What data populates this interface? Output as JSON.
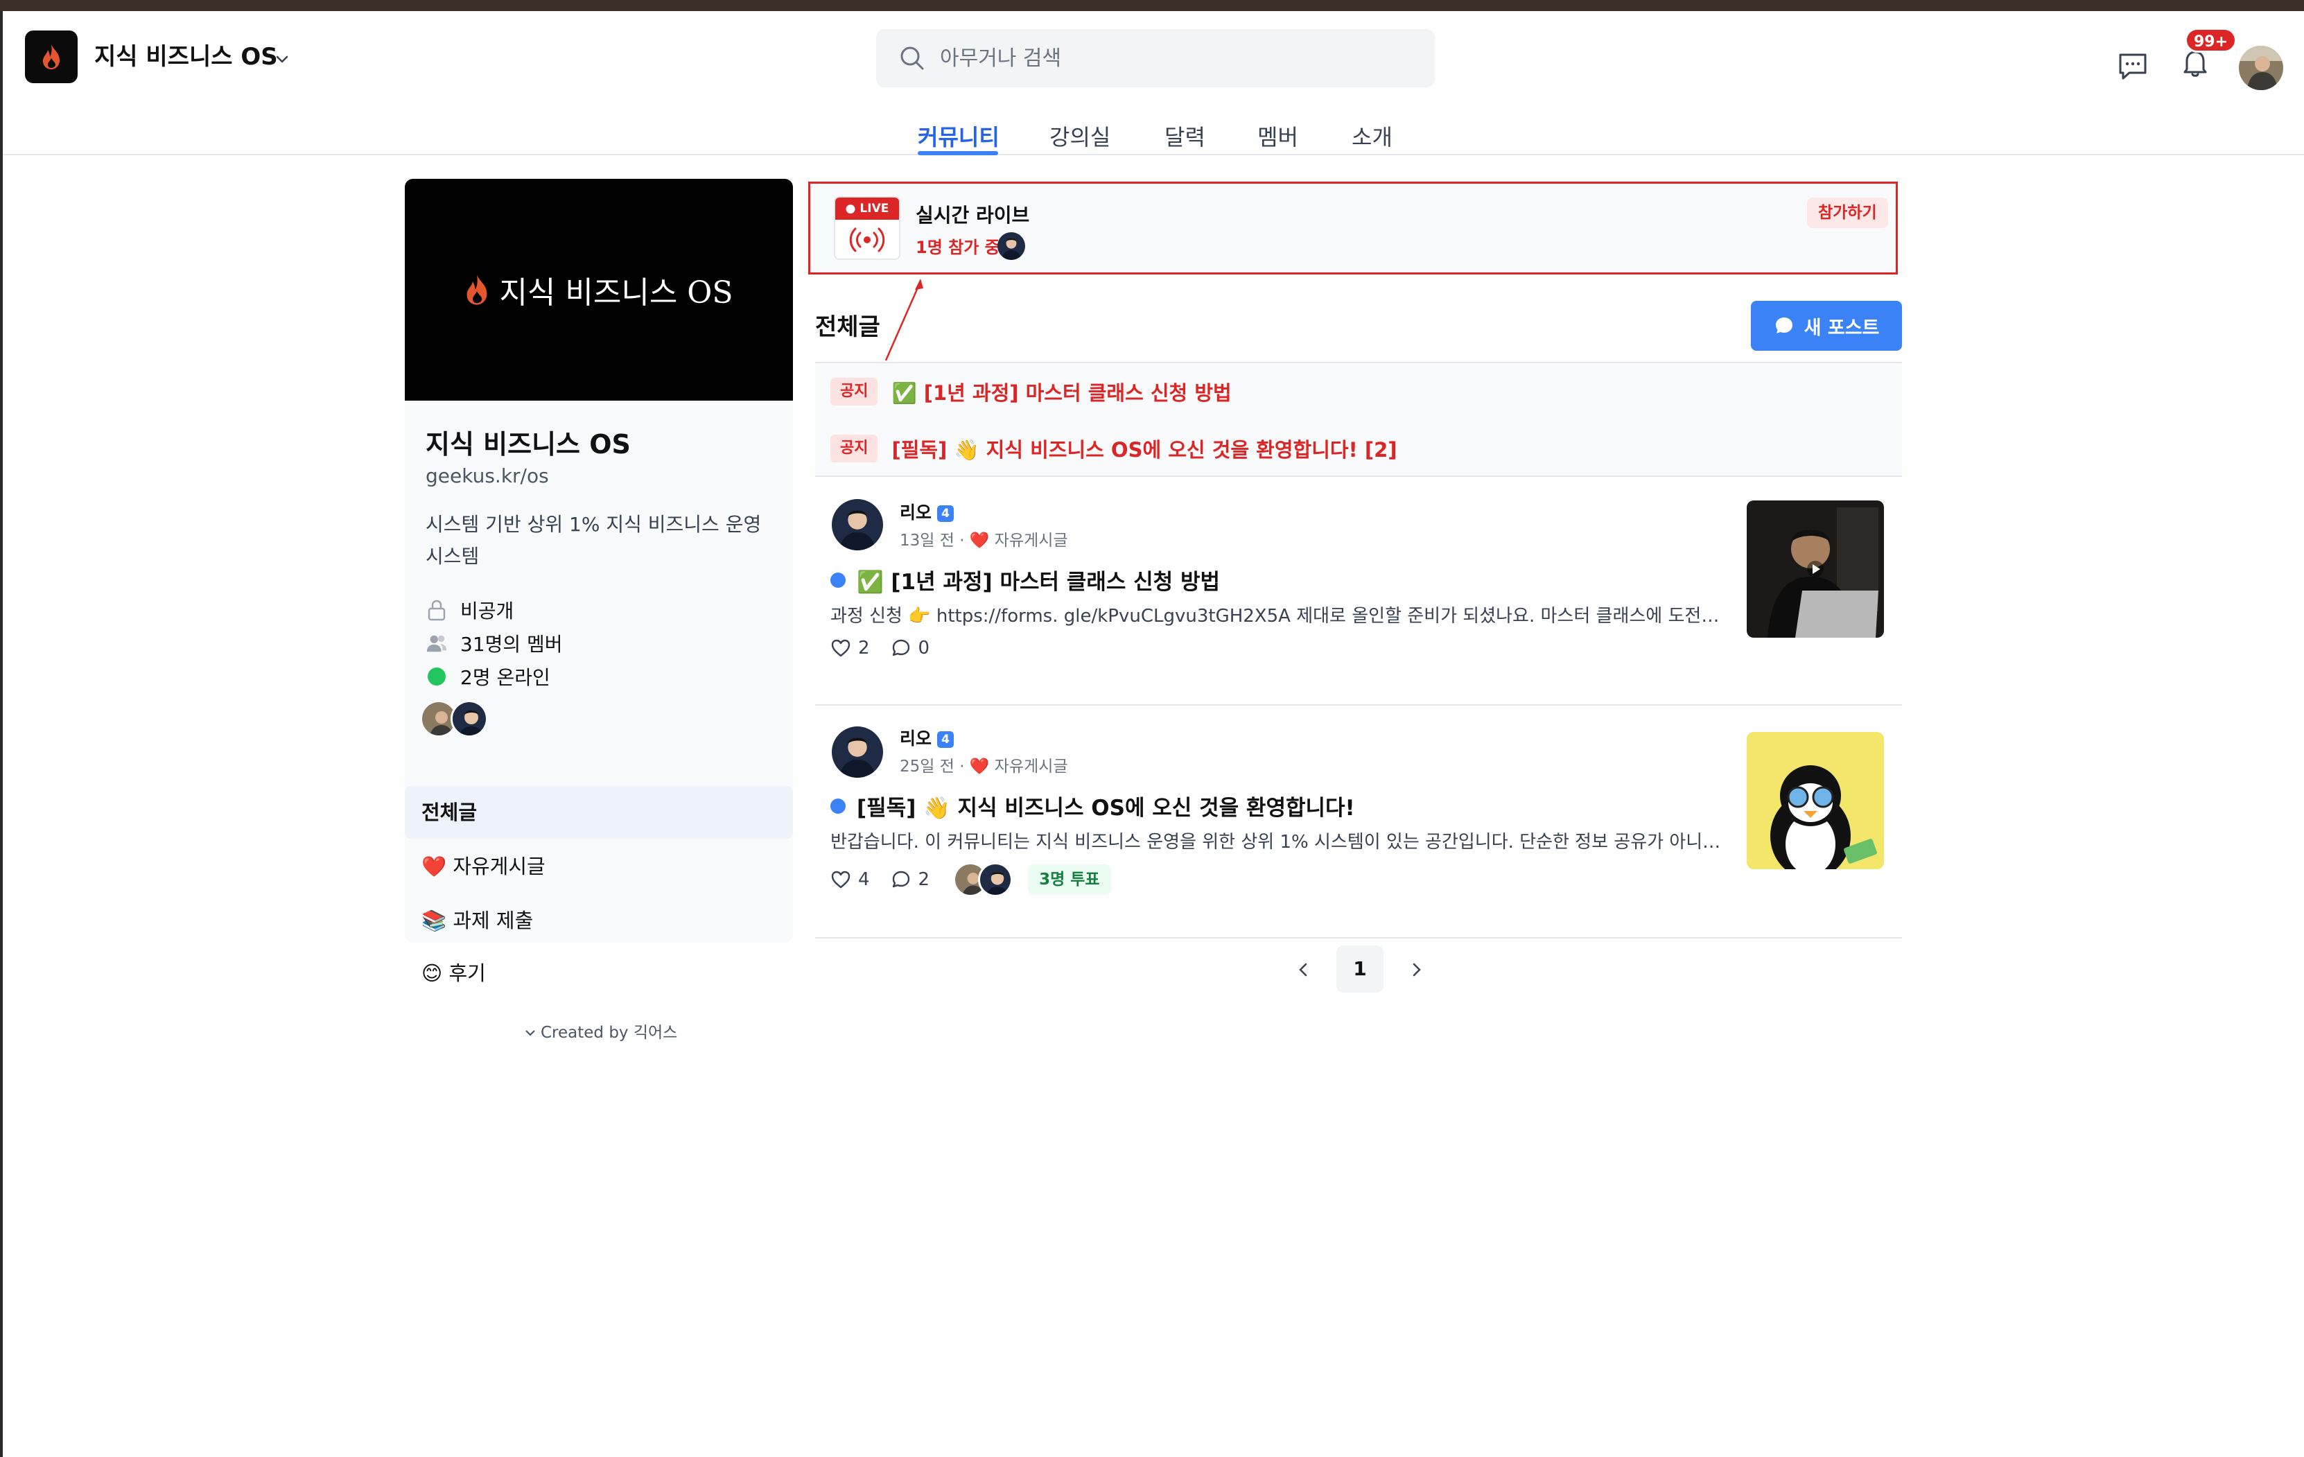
{
  "app": {
    "title": "지식 비즈니스 OS"
  },
  "search": {
    "placeholder": "아무거나 검색"
  },
  "notifications": {
    "badge": "99+"
  },
  "nav_tabs": [
    {
      "label": "커뮤니티",
      "active": true
    },
    {
      "label": "강의실",
      "active": false
    },
    {
      "label": "달력",
      "active": false
    },
    {
      "label": "멤버",
      "active": false
    },
    {
      "label": "소개",
      "active": false
    }
  ],
  "sidebar": {
    "cover_text": "지식 비즈니스 OS",
    "name": "지식 비즈니스 OS",
    "url": "geekus.kr/os",
    "description": "시스템 기반 상위 1% 지식 비즈니스 운영 시스템",
    "privacy": "비공개",
    "members": "31명의 멤버",
    "online": "2명 온라인",
    "categories": [
      {
        "label": "전체글",
        "active": true
      },
      {
        "label": "❤️ 자유게시글",
        "active": false
      },
      {
        "label": "📚 과제 제출",
        "active": false
      },
      {
        "label": "😊 후기",
        "active": false
      }
    ],
    "created_by": "Created by 긱어스"
  },
  "live": {
    "tag": "LIVE",
    "title": "실시간 라이브",
    "participants": "1명 참가 중",
    "join_label": "참가하기"
  },
  "feed": {
    "section_title": "전체글",
    "new_post_label": "새 포스트",
    "notices": [
      {
        "tag": "공지",
        "title": "✅ [1년 과정] 마스터 클래스 신청 방법"
      },
      {
        "tag": "공지",
        "title": "[필독] 👋 지식 비즈니스 OS에 오신 것을 환영합니다!  [2]"
      }
    ],
    "posts": [
      {
        "author": "리오",
        "level": "4",
        "time": "13일 전",
        "category": "❤️ 자유게시글",
        "title": "✅ [1년 과정] 마스터 클래스 신청 방법",
        "excerpt": "과정 신청 👉 https://forms. gle/kPvuCLgvu3tGH2X5A 제대로 올인할 준비가 되셨나요. 마스터 클래스에 도전해...",
        "likes": "2",
        "comments": "0"
      },
      {
        "author": "리오",
        "level": "4",
        "time": "25일 전",
        "category": "❤️ 자유게시글",
        "title": "[필독] 👋 지식 비즈니스 OS에 오신 것을 환영합니다!",
        "excerpt": "반갑습니다. 이 커뮤니티는 지식 비즈니스 운영을 위한 상위 1% 시스템이 있는 공간입니다. 단순한 정보 공유가 아니라...",
        "likes": "4",
        "comments": "2",
        "votes": "3명 투표"
      }
    ]
  },
  "pagination": {
    "current": "1"
  },
  "colors": {
    "accent": "#3b82f6",
    "danger": "#dc2626",
    "online": "#22c55e"
  }
}
